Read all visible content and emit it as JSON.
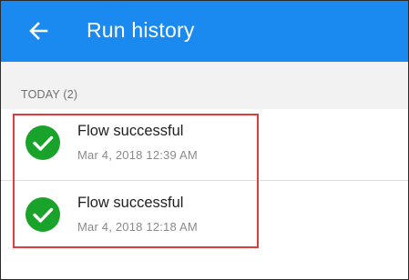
{
  "appbar": {
    "title": "Run history",
    "back_icon": "arrow-left-icon",
    "color": "#1a8af0"
  },
  "section": {
    "header": "TODAY (2)"
  },
  "runs": [
    {
      "status_icon": "check-circle-icon",
      "status_color": "#1aa32a",
      "title": "Flow successful",
      "timestamp": "Mar 4, 2018 12:39 AM"
    },
    {
      "status_icon": "check-circle-icon",
      "status_color": "#1aa32a",
      "title": "Flow successful",
      "timestamp": "Mar 4, 2018 12:18 AM"
    }
  ],
  "annotation": {
    "highlight_color": "#e23b3b"
  }
}
